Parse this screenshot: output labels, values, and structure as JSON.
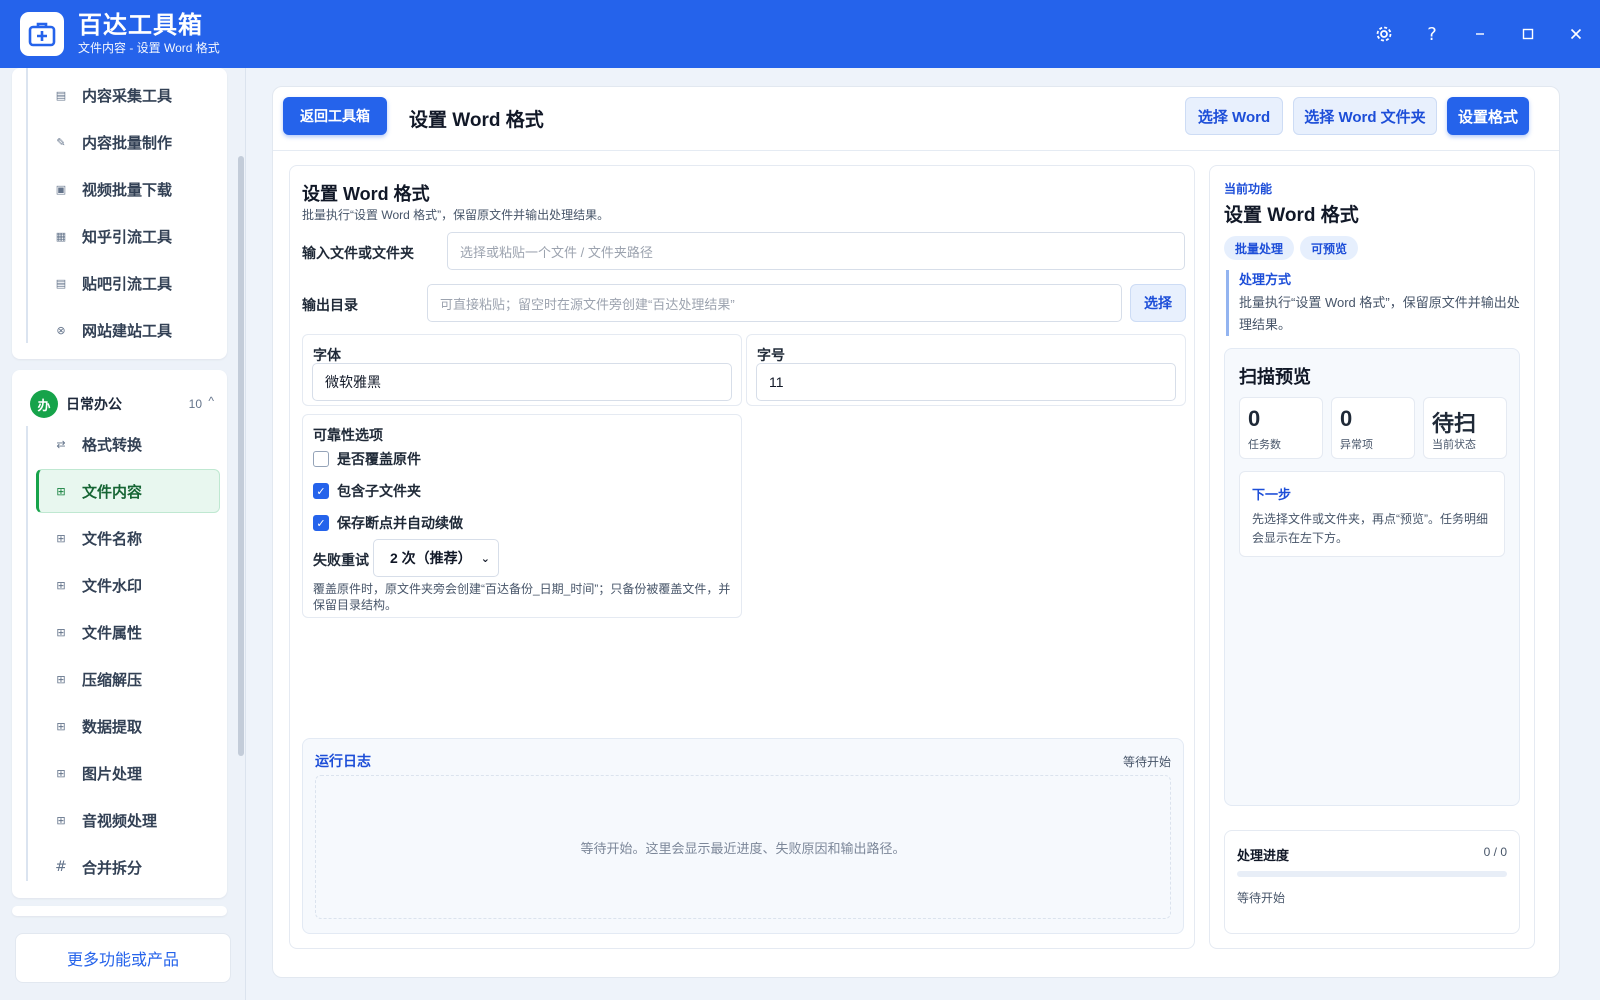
{
  "app": {
    "name": "百达工具箱",
    "subtitle": "文件内容 - 设置 Word 格式"
  },
  "window_controls": [
    "settings-icon",
    "help-icon",
    "minimize-icon",
    "maximize-icon",
    "close-icon"
  ],
  "sidebar": {
    "group_top_items": [
      {
        "label": "内容采集工具",
        "icon": "collect-icon"
      },
      {
        "label": "内容批量制作",
        "icon": "edit-icon"
      },
      {
        "label": "视频批量下载",
        "icon": "video-icon"
      },
      {
        "label": "知乎引流工具",
        "icon": "zhihu-icon"
      },
      {
        "label": "贴吧引流工具",
        "icon": "tieba-icon"
      },
      {
        "label": "网站建站工具",
        "icon": "web-icon"
      }
    ],
    "group": {
      "badge": "办",
      "name": "日常办公",
      "count": "10",
      "caret": "^"
    },
    "group_items": [
      {
        "label": "格式转换",
        "icon": "convert-icon"
      },
      {
        "label": "文件内容",
        "icon": "grid-icon",
        "active": true
      },
      {
        "label": "文件名称",
        "icon": "grid-icon"
      },
      {
        "label": "文件水印",
        "icon": "grid-icon"
      },
      {
        "label": "文件属性",
        "icon": "grid-icon"
      },
      {
        "label": "压缩解压",
        "icon": "grid-icon"
      },
      {
        "label": "数据提取",
        "icon": "grid-icon"
      },
      {
        "label": "图片处理",
        "icon": "grid-icon"
      },
      {
        "label": "音视频处理",
        "icon": "grid-icon"
      },
      {
        "label": "合并拆分",
        "icon": "hash-icon"
      }
    ],
    "more_button": "更多功能或产品"
  },
  "topbar": {
    "back_button": "返回工具箱",
    "page_title": "设置 Word 格式",
    "select_word": "选择 Word",
    "select_folder": "选择 Word 文件夹",
    "set_format": "设置格式"
  },
  "form": {
    "title": "设置 Word 格式",
    "description": "批量执行“设置 Word 格式”，保留原文件并输出处理结果。",
    "input_label": "输入文件或文件夹",
    "input_placeholder": "选择或粘贴一个文件 / 文件夹路径",
    "output_label": "输出目录",
    "output_placeholder": "可直接粘贴；留空时在源文件旁创建“百达处理结果”",
    "output_button": "选择",
    "font_label": "字体",
    "font_value": "微软雅黑",
    "size_label": "字号",
    "size_value": "11",
    "reliability": {
      "title": "可靠性选项",
      "options": [
        {
          "label": "是否覆盖原件",
          "checked": false
        },
        {
          "label": "包含子文件夹",
          "checked": true
        },
        {
          "label": "保存断点并自动续做",
          "checked": true
        }
      ],
      "retry_label": "失败重试",
      "retry_value": "2 次（推荐）",
      "note": "覆盖原件时，原文件夹旁会创建“百达备份_日期_时间”；只备份被覆盖文件，并保留目录结构。"
    }
  },
  "log": {
    "title": "运行日志",
    "status": "等待开始",
    "placeholder": "等待开始。这里会显示最近进度、失败原因和输出路径。"
  },
  "side": {
    "label": "当前功能",
    "title": "设置 Word 格式",
    "tags": [
      "批量处理",
      "可预览"
    ],
    "method_title": "处理方式",
    "method_desc": "批量执行“设置 Word 格式”，保留原文件并输出处理结果。",
    "scan": {
      "title": "扫描预览",
      "stats": [
        {
          "value": "0",
          "label": "任务数"
        },
        {
          "value": "0",
          "label": "异常项"
        },
        {
          "value": "待扫",
          "label": "当前状态"
        }
      ],
      "next_title": "下一步",
      "next_desc": "先选择文件或文件夹，再点“预览”。任务明细会显示在左下方。"
    },
    "progress": {
      "title": "处理进度",
      "count": "0 / 0",
      "fraction": 0,
      "status": "等待开始"
    }
  },
  "colors": {
    "primary": "#2563eb",
    "active_green": "#16a34a",
    "background": "#eef3fa"
  }
}
